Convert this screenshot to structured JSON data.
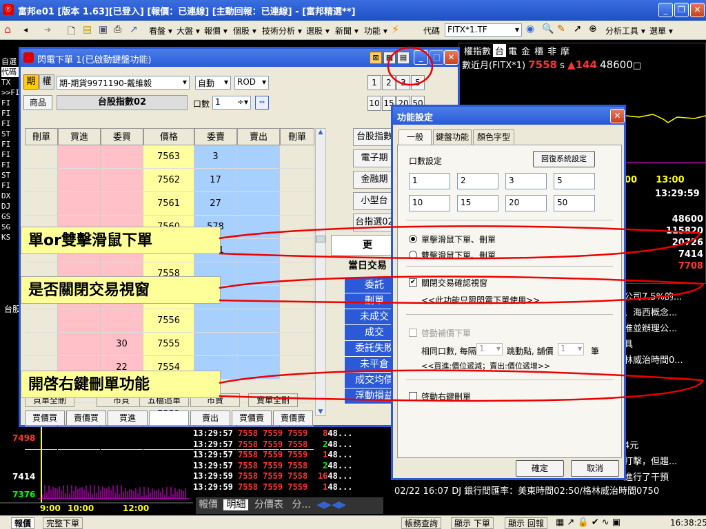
{
  "window": {
    "title": "富邦e01 [版本 1.63][已登入] [報價：已連線] [主動回報：已連線] - [富邦精選**]",
    "app_logo": "Ⓔ"
  },
  "toolbar": {
    "menus": [
      "看盤",
      "大盤",
      "報價",
      "個股",
      "技術分析",
      "選股",
      "新聞",
      "功能"
    ],
    "code_label": "代碼",
    "code_value": "FITX*1.TF",
    "tools_menu": "分析工具",
    "select_menu": "選單"
  },
  "flash_window": {
    "title": "閃電下單 1(已啟動鍵盤功能)",
    "tab_futures": "期",
    "tab_options": "權",
    "account": "期-期貨9971190-戴維毅",
    "order_type": "自動",
    "order_cond": "ROD",
    "product_label": "商品",
    "product_value": "台股指數02",
    "qty_label": "口數",
    "qty_value": "1",
    "qty_presets_row1": [
      "1",
      "2",
      "3",
      "5"
    ],
    "qty_presets_row2": [
      "10",
      "15",
      "20",
      "50"
    ],
    "headers": [
      "刪單",
      "買進",
      "委買",
      "價格",
      "委賣",
      "賣出",
      "刪單"
    ],
    "prices": [
      "7563",
      "7562",
      "7561",
      "7560",
      "7559",
      "7558",
      "7557",
      "7556",
      "7555",
      "7554",
      "7553",
      "7552",
      "7551"
    ],
    "asks": [
      "3",
      "17",
      "27",
      "578",
      "141",
      "",
      "",
      "",
      "",
      "",
      "",
      "",
      ""
    ],
    "bids": [
      "",
      "",
      "",
      "",
      "",
      "",
      "535",
      "",
      "30",
      "22",
      "",
      "",
      ""
    ],
    "categories": [
      "台股指數",
      "電子期",
      "金融期",
      "小型台",
      "台指選02"
    ],
    "more_btn": "更",
    "today_trade": "當日交易",
    "status_items": [
      "委託",
      "刪單",
      "未成交",
      "成交",
      "委託失敗",
      "未平倉",
      "成交均價",
      "浮動損益"
    ],
    "bottom_buttons": [
      "買價買",
      "賣價買",
      "買進",
      "",
      "賣出",
      "買價賣",
      "賣價賣"
    ],
    "bottom_labels": [
      "買單全刪",
      "市買",
      "五檔追單",
      "市賣",
      "賣單全刪"
    ]
  },
  "callouts": {
    "c1": "單or雙擊滑鼠下單",
    "c2": "是否關閉交易視窗",
    "c3": "開啓右鍵刪單功能"
  },
  "dialog": {
    "title": "功能設定",
    "tabs": [
      "一般",
      "鍵盤功能",
      "顏色字型"
    ],
    "qty_setting": "口數設定",
    "restore_btn": "回復系統設定",
    "qty_row1": [
      "1",
      "2",
      "3",
      "5"
    ],
    "qty_row2": [
      "10",
      "15",
      "20",
      "50"
    ],
    "radio_single": "單擊滑鼠下單、刪單",
    "radio_double": "雙擊滑鼠下單、刪單",
    "close_confirm": "關閉交易確認視窗",
    "close_note": "<<此功能只限閃電下單使用>>",
    "chase": "啓動補價下單",
    "chase_line_a": "相同口數, 每隔",
    "chase_val1": "1",
    "chase_line_b": "跳動點, 舖價",
    "chase_val2": "1",
    "chase_line_c": "筆",
    "chase_note": "<<買進:價位遞減；賣出:價位遞增>>",
    "right_delete": "啓動右鍵刪單",
    "ok": "確定",
    "cancel": "取消"
  },
  "right_panel": {
    "tabs": [
      "權指數",
      "台",
      "電",
      "金",
      "櫃",
      "非",
      "摩"
    ],
    "title": "數近月(FITX*1)",
    "price": "7558",
    "price_flag": "s",
    "change": "▲144",
    "volume": "48600",
    "time_labels": [
      "00",
      "13:00"
    ],
    "clock": "13:29:59",
    "values": [
      "48600",
      "115820",
      "20726",
      "7414",
      "7708"
    ]
  },
  "chart_left": {
    "y_labels": [
      "7498",
      "7414",
      "7376"
    ],
    "x_labels": [
      "9:00",
      "10:00",
      "12:00"
    ],
    "tabs": [
      "報價",
      "明細",
      "分價表",
      "分..."
    ]
  },
  "ticks": [
    {
      "time": "13:29:57",
      "p1": "7558",
      "p2": "7559",
      "p3": "7559",
      "v": "8",
      "t": "48..."
    },
    {
      "time": "13:29:57",
      "p1": "7558",
      "p2": "7559",
      "p3": "7558",
      "v": "2",
      "t": "48..."
    },
    {
      "time": "13:29:57",
      "p1": "7558",
      "p2": "7559",
      "p3": "7559",
      "v": "1",
      "t": "48..."
    },
    {
      "time": "13:29:57",
      "p1": "7558",
      "p2": "7559",
      "p3": "7558",
      "v": "2",
      "t": "48..."
    },
    {
      "time": "13:29:59",
      "p1": "7558",
      "p2": "7559",
      "p3": "7558",
      "v": "16",
      "t": "48..."
    },
    {
      "time": "13:29:59",
      "p1": "7558",
      "p2": "7559",
      "p3": "7559",
      "v": "1",
      "t": "48..."
    }
  ],
  "news": {
    "lines": [
      "公司7.5%的...",
      "、海西概念...",
      "准並辦理公...",
      "具",
      "林威治時間0..."
    ],
    "lines2": [
      "4元",
      "打擊，但趨...",
      "進行了干預"
    ],
    "bottom": "02/22 16:07   DJ 銀行間匯率：美東時間02:50/格林威治時間0750"
  },
  "left_strip": {
    "top": "自選",
    "code": "代碼",
    "rows": [
      "TX",
      ">>FI",
      "FI",
      "FI",
      "FI",
      "ST",
      "FI",
      "FI",
      "FI",
      "ST",
      "FI",
      "DX",
      "DJ",
      "GS",
      "SG",
      "KS"
    ],
    "bottom": "台股"
  },
  "statusbar": {
    "left": [
      "報價",
      "完整下單"
    ],
    "mid": [
      "帳務查詢",
      "顯示 下單",
      "顯示 回報"
    ],
    "time": "16:38:25"
  }
}
